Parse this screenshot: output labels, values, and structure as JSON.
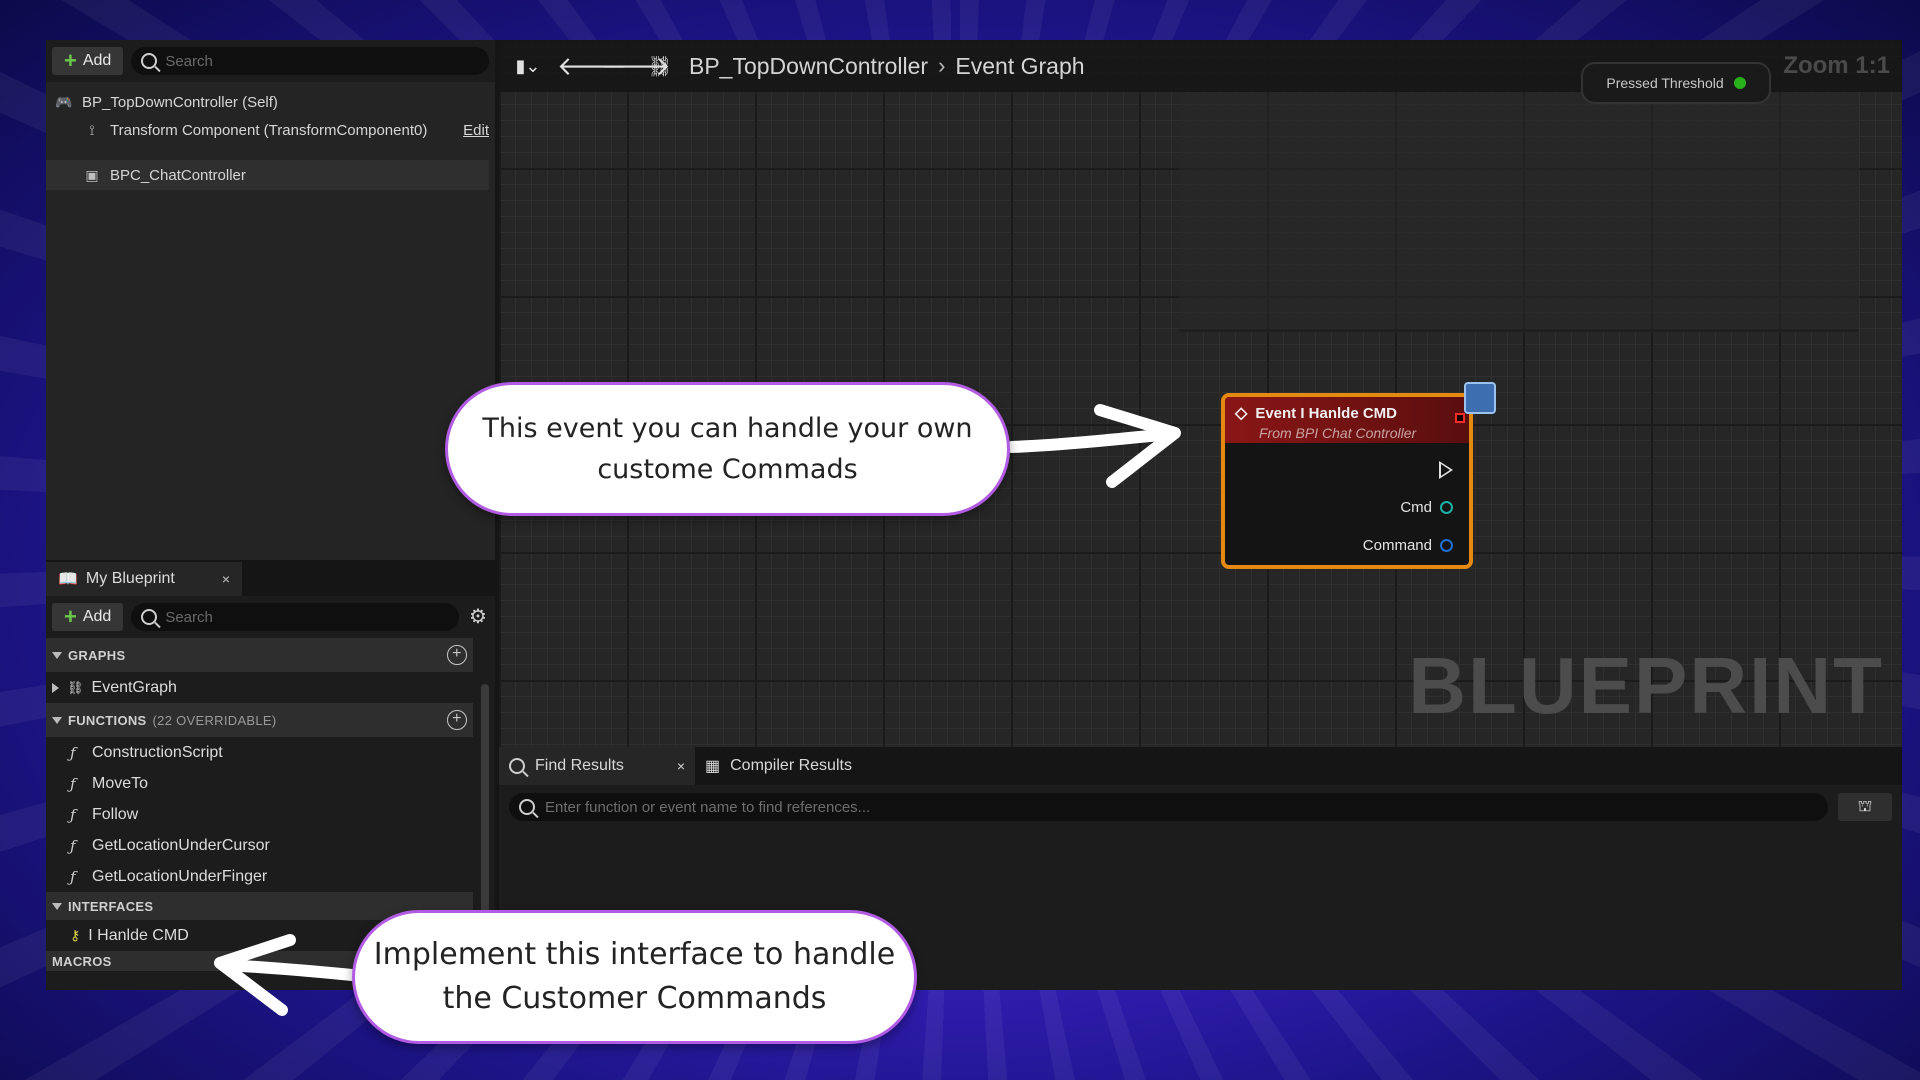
{
  "components_panel": {
    "add_label": "Add",
    "search_placeholder": "Search",
    "rows": [
      {
        "label": "BP_TopDownController (Self)",
        "icon": "gamepad-icon"
      },
      {
        "label": "Transform Component (TransformComponent0)",
        "icon": "transform-icon",
        "action": "Edit"
      },
      {
        "label": "BPC_ChatController",
        "icon": "component-icon"
      }
    ]
  },
  "my_blueprint": {
    "tab_label": "My Blueprint",
    "tab_close": "×",
    "add_label": "Add",
    "search_placeholder": "Search",
    "sections": {
      "graphs": {
        "title": "GRAPHS",
        "items": [
          "EventGraph"
        ]
      },
      "functions": {
        "title": "FUNCTIONS",
        "subtitle": "(22 OVERRIDABLE)",
        "items": [
          "ConstructionScript",
          "MoveTo",
          "Follow",
          "GetLocationUnderCursor",
          "GetLocationUnderFinger"
        ]
      },
      "interfaces": {
        "title": "INTERFACES",
        "items": [
          "I Hanlde CMD"
        ]
      },
      "macros": {
        "title": "MACROS"
      }
    }
  },
  "graph": {
    "breadcrumb": [
      "BP_TopDownController",
      "Event Graph"
    ],
    "zoom": "Zoom 1:1",
    "pressed_node_label": "Pressed Threshold",
    "watermark": "BLUEPRINT",
    "node": {
      "title": "Event I Hanlde CMD",
      "subtitle": "From BPI Chat Controller",
      "pins": [
        "Cmd",
        "Command"
      ],
      "border_color": "#e48a10",
      "header_color": "#8a1616"
    }
  },
  "results_panel": {
    "tabs": [
      "Find Results",
      "Compiler Results"
    ],
    "tab_close": "×",
    "find_placeholder": "Enter function or event name to find references..."
  },
  "callouts": {
    "event_note": "This event you can handle your own custome Commads",
    "interface_note": "Implement this interface to handle the Customer Commands"
  },
  "colors": {
    "background_accent": "#3b22c8",
    "callout_border": "#b25be3"
  }
}
